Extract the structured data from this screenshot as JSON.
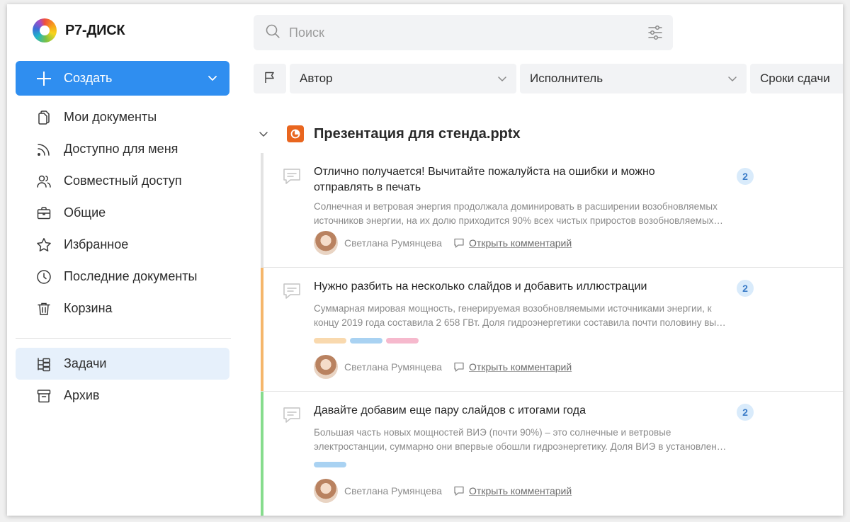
{
  "app": {
    "name": "Р7-ДИСК"
  },
  "sidebar": {
    "create_label": "Создать",
    "items": [
      {
        "label": "Мои документы",
        "icon": "documents-icon"
      },
      {
        "label": "Доступно для меня",
        "icon": "rss-icon"
      },
      {
        "label": "Совместный доступ",
        "icon": "users-icon"
      },
      {
        "label": "Общие",
        "icon": "briefcase-icon"
      },
      {
        "label": "Избранное",
        "icon": "star-icon"
      },
      {
        "label": "Последние документы",
        "icon": "clock-icon"
      },
      {
        "label": "Корзина",
        "icon": "trash-icon"
      }
    ],
    "items2": [
      {
        "label": "Задачи",
        "icon": "tasks-icon",
        "active": true
      },
      {
        "label": "Архив",
        "icon": "archive-icon"
      }
    ]
  },
  "search": {
    "placeholder": "Поиск",
    "value": ""
  },
  "filters": {
    "author": "Автор",
    "assignee": "Исполнитель",
    "deadline": "Сроки сдачи"
  },
  "document": {
    "title": "Презентация для стенда.pptx",
    "icon_color": "#e9661f"
  },
  "tasks": [
    {
      "title": "Отлично получается! Вычитайте пожалуйста на ошибки и можно отправлять в печать",
      "count": "2",
      "desc_line1": "Солнечная и ветровая энергия продолжала доминировать в расширении возобновляемых",
      "desc_line2": "источников энергии, на их долю приходится 90% всех чистых приростов возобновляемых…",
      "author": "Светлана Румянцева",
      "link": "Открыть комментарий",
      "bar_color": "#e3e3e3",
      "tags": []
    },
    {
      "title": "Нужно разбить на несколько слайдов и добавить иллюстрации",
      "count": "2",
      "desc_line1": "Суммарная мировая мощность, генерируемая возобновляемыми источниками энергии, к",
      "desc_line2": "концу 2019 года составила 2 658 ГВт. Доля гидроэнергетики составила почти половину вы…",
      "author": "Светлана Румянцева",
      "link": "Открыть комментарий",
      "bar_color": "#f5b66b",
      "tags": [
        "#f9d9ae",
        "#a9d2f2",
        "#f6b9cd"
      ]
    },
    {
      "title": "Давайте добавим еще пару слайдов с итогами года",
      "count": "2",
      "desc_line1": "Большая часть новых мощностей ВИЭ (почти 90%) – это солнечные и ветровые",
      "desc_line2": "электростанции, суммарно они впервые обошли гидроэнергетику. Доля ВИЭ в установлен…",
      "author": "Светлана Румянцева",
      "link": "Открыть комментарий",
      "bar_color": "#86dc8d",
      "tags": [
        "#a9d2f2"
      ]
    }
  ]
}
